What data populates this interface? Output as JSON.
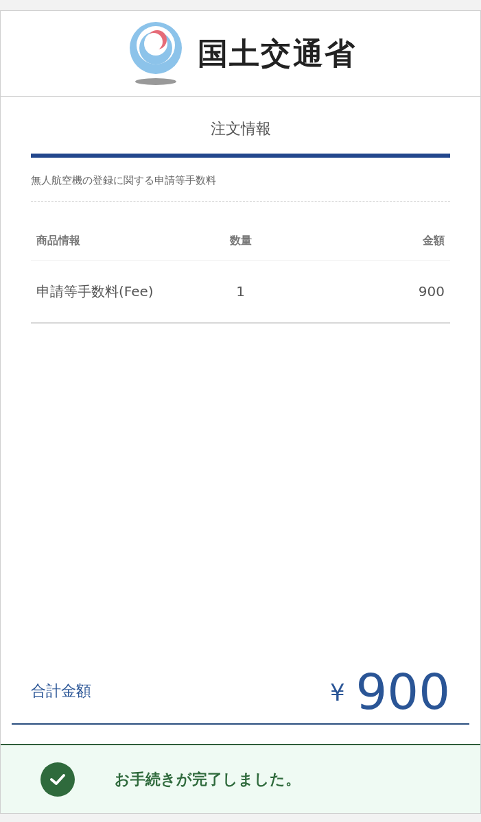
{
  "header": {
    "logo_text": "国土交通省"
  },
  "order": {
    "title": "注文情報",
    "subtitle": "無人航空機の登録に関する申請等手数料",
    "columns": [
      "商品情報",
      "数量",
      "金額"
    ],
    "rows": [
      {
        "item": "申請等手数料(Fee)",
        "quantity": "1",
        "amount": "900"
      }
    ]
  },
  "total": {
    "label": "合計金額",
    "currency": "¥",
    "amount": "900"
  },
  "notice": {
    "kind": "success",
    "message": "お手続きが完了しました。"
  }
}
